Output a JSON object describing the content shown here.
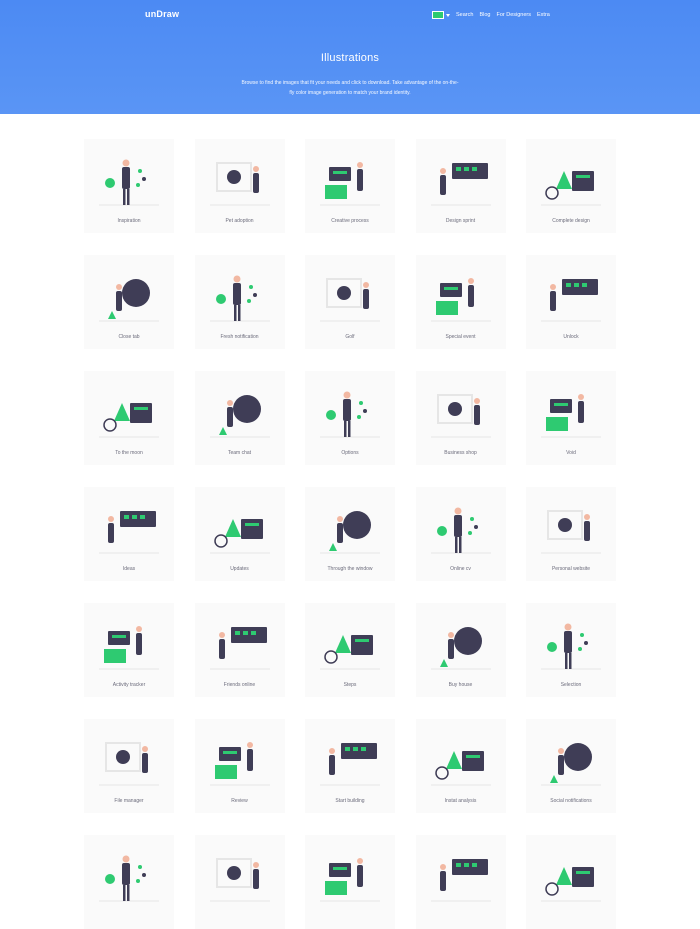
{
  "header": {
    "brand": "unDraw",
    "nav": [
      "Search",
      "Blog",
      "For Designers",
      "Extra"
    ],
    "accent_color": "#2eca71"
  },
  "hero": {
    "title": "Illustrations",
    "subtitle": "Browse to find the images that fit your needs and click to download. Take advantage of the on-the-fly color image generation to match your brand identity."
  },
  "illustrations": [
    "Inspiration",
    "Pet adoption",
    "Creative process",
    "Design sprint",
    "Complete design",
    "Close tab",
    "Fresh notification",
    "Golf",
    "Special event",
    "Unlock",
    "To the moon",
    "Team chat",
    "Options",
    "Business shop",
    "Void",
    "Ideas",
    "Updates",
    "Through the window",
    "Online cv",
    "Personal website",
    "Activity tracker",
    "Friends online",
    "Steps",
    "Buy house",
    "Selection",
    "File manager",
    "Review",
    "Start building",
    "Instat analysis",
    "Social notifications",
    "",
    "",
    "",
    "",
    ""
  ]
}
